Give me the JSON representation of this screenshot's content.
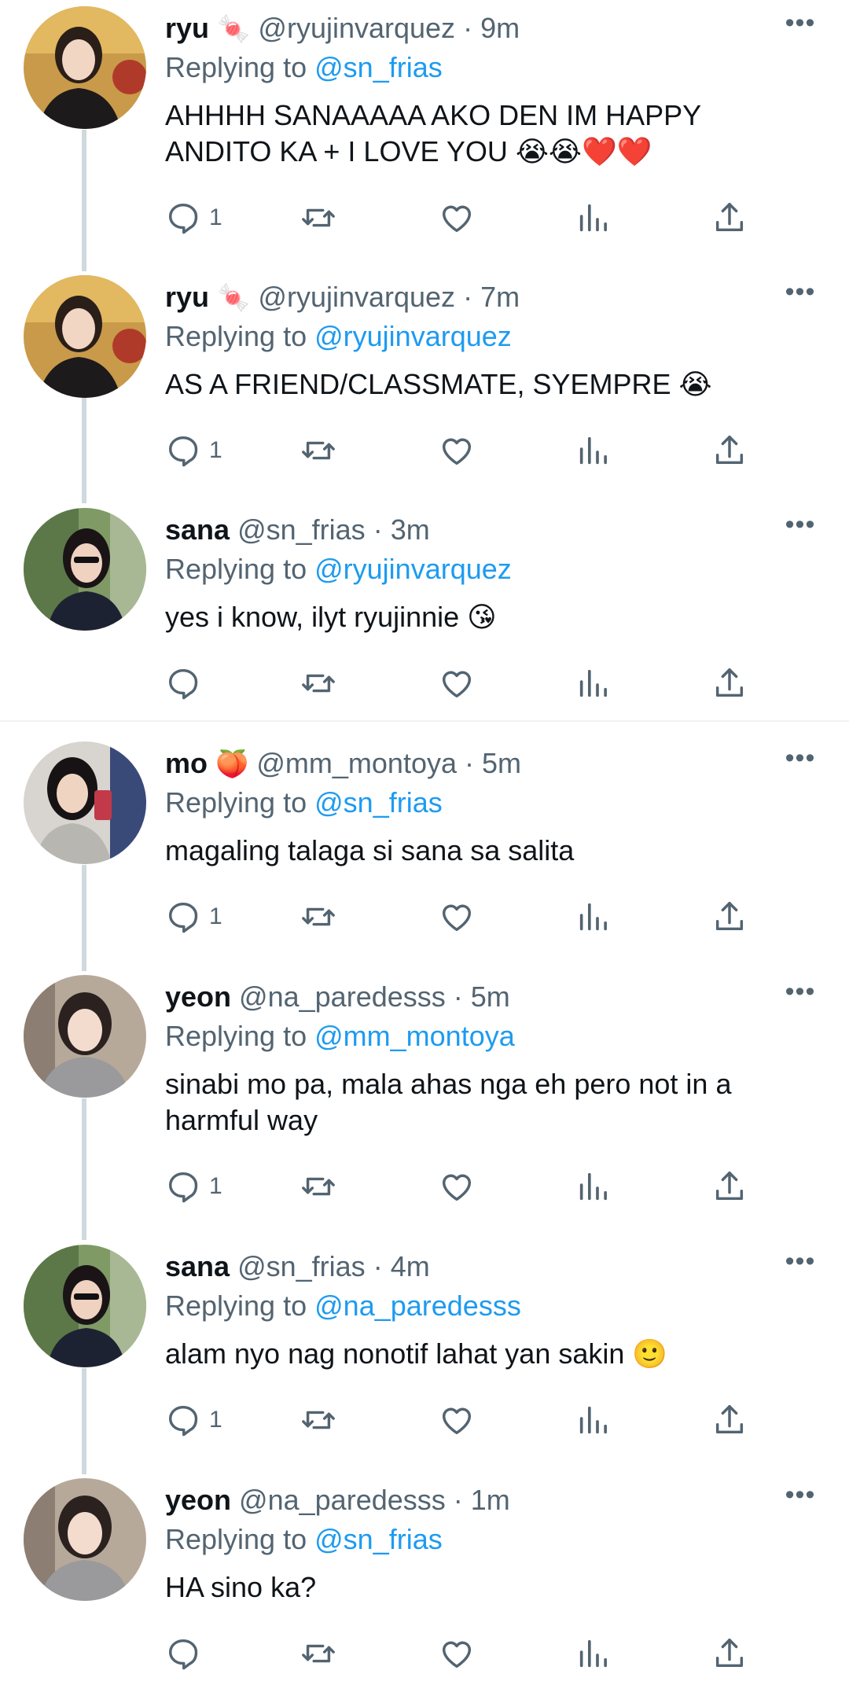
{
  "tweets": [
    {
      "name": "ryu",
      "name_emoji": "🍬",
      "handle": "@ryujinvarquez",
      "time": "· 9m",
      "replying_prefix": "Replying to",
      "replying_to": "@sn_frias",
      "text_lines": [
        "AHHHH SANAAAAA AKO DEN IM HAPPY",
        "ANDITO KA + I LOVE YOU"
      ],
      "text_emoji": "😭😭❤️❤️",
      "reply_count": "1",
      "avatar": "avatar-ryu"
    },
    {
      "name": "ryu",
      "name_emoji": "🍬",
      "handle": "@ryujinvarquez",
      "time": "· 7m",
      "replying_prefix": "Replying to",
      "replying_to": "@ryujinvarquez",
      "text_lines": [
        "AS A FRIEND/CLASSMATE, SYEMPRE"
      ],
      "text_emoji": "😭",
      "reply_count": "1",
      "avatar": "avatar-ryu"
    },
    {
      "name": "sana",
      "name_emoji": "",
      "handle": "@sn_frias",
      "time": "· 3m",
      "replying_prefix": "Replying to",
      "replying_to": "@ryujinvarquez",
      "text_lines": [
        "yes i know, ilyt ryujinnie"
      ],
      "text_emoji": "😘",
      "reply_count": "",
      "avatar": "avatar-sana"
    },
    {
      "name": "mo",
      "name_emoji": "🍑",
      "handle": "@mm_montoya",
      "time": "· 5m",
      "replying_prefix": "Replying to",
      "replying_to": "@sn_frias",
      "text_lines": [
        "magaling talaga si sana sa salita"
      ],
      "text_emoji": "",
      "reply_count": "1",
      "avatar": "avatar-mo"
    },
    {
      "name": "yeon",
      "name_emoji": "",
      "handle": "@na_paredesss",
      "time": "· 5m",
      "replying_prefix": "Replying to",
      "replying_to": "@mm_montoya",
      "text_lines": [
        "sinabi mo pa, mala ahas nga eh pero not in a",
        "harmful way"
      ],
      "text_emoji": "",
      "reply_count": "1",
      "avatar": "avatar-yeon"
    },
    {
      "name": "sana",
      "name_emoji": "",
      "handle": "@sn_frias",
      "time": "· 4m",
      "replying_prefix": "Replying to",
      "replying_to": "@na_paredesss",
      "text_lines": [
        "alam nyo nag nonotif lahat yan sakin"
      ],
      "text_emoji": "🙂",
      "reply_count": "1",
      "avatar": "avatar-sana"
    },
    {
      "name": "yeon",
      "name_emoji": "",
      "handle": "@na_paredesss",
      "time": "· 1m",
      "replying_prefix": "Replying to",
      "replying_to": "@sn_frias",
      "text_lines": [
        "HA sino ka?"
      ],
      "text_emoji": "",
      "reply_count": "",
      "avatar": "avatar-yeon"
    }
  ],
  "more_label": "•••",
  "colors": {
    "text": "#0f1419",
    "secondary": "#536471",
    "link": "#1d9bf0",
    "thread_line": "#cfd9de",
    "separator": "#eff3f4"
  },
  "icons": [
    "reply-icon",
    "retweet-icon",
    "like-icon",
    "views-icon",
    "share-icon",
    "more-icon"
  ]
}
